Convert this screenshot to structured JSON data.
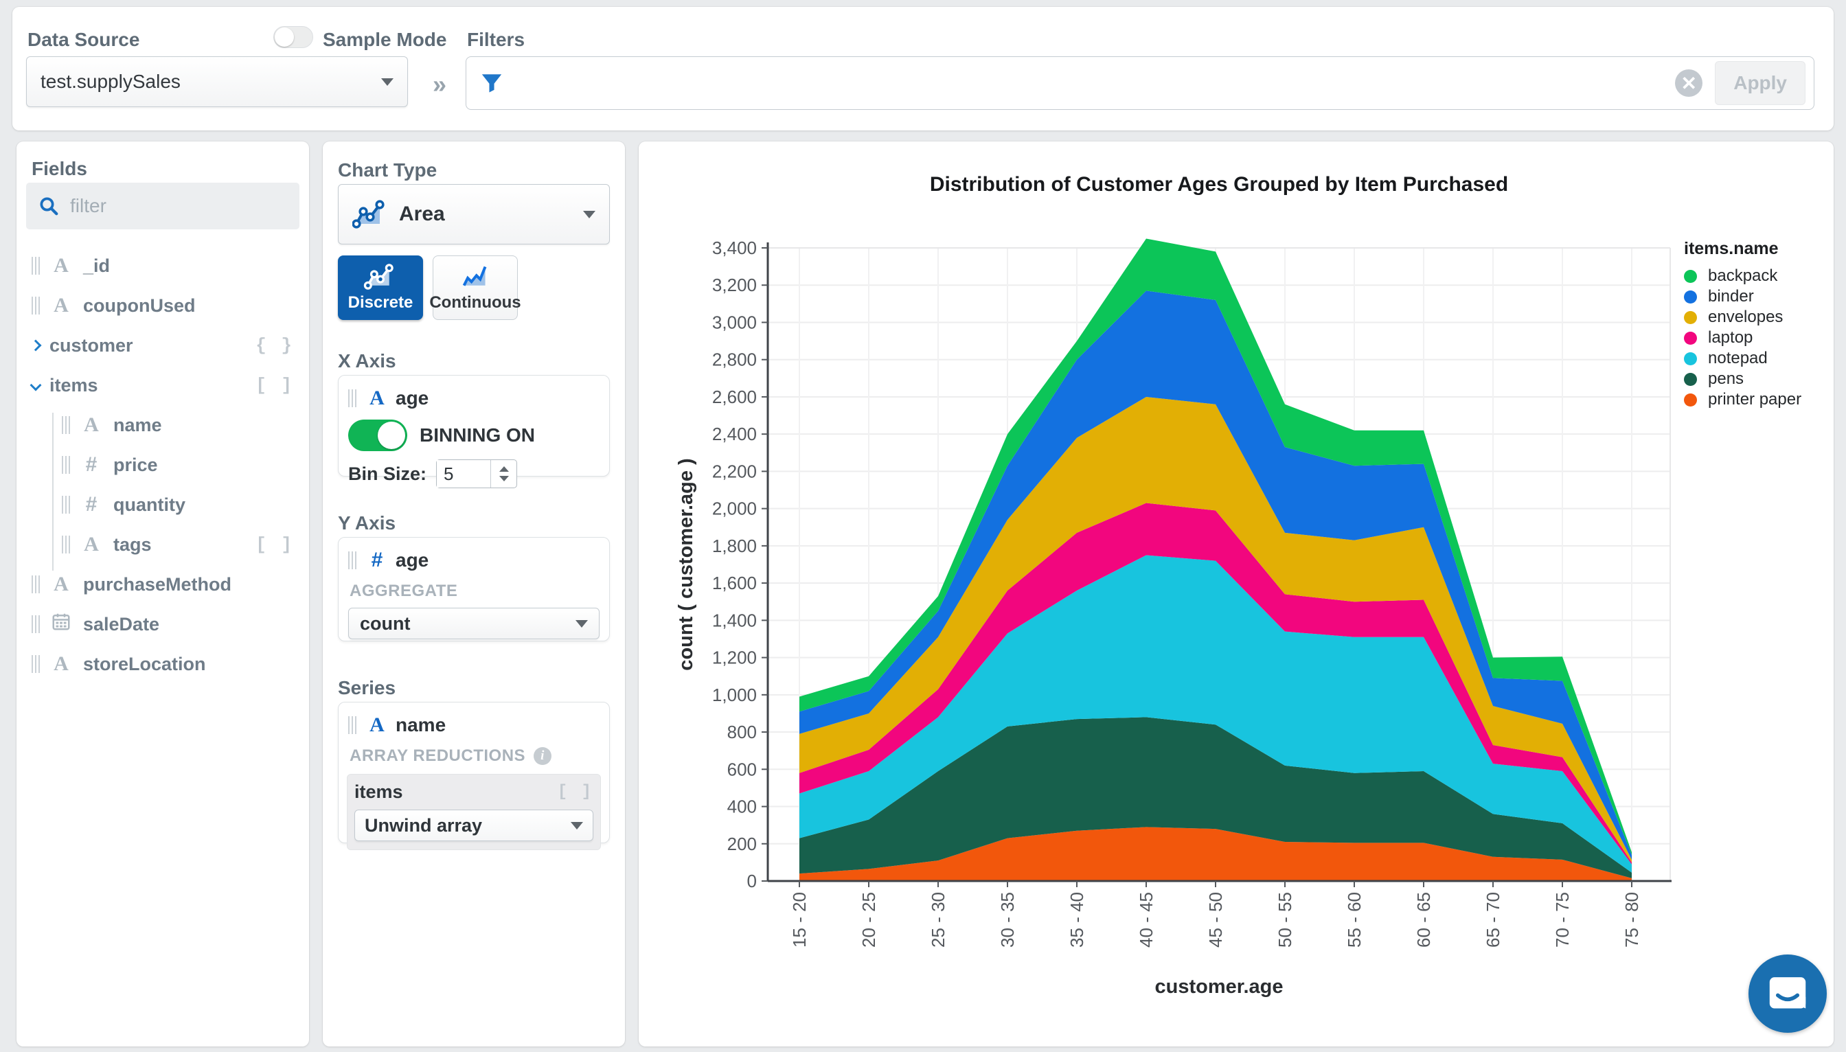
{
  "topbar": {
    "data_source_label": "Data Source",
    "data_source_value": "test.supplySales",
    "sample_mode_label": "Sample Mode",
    "sample_mode_on": false,
    "filters_label": "Filters",
    "filters_value": "",
    "apply_label": "Apply"
  },
  "fields_panel": {
    "title": "Fields",
    "filter_placeholder": "filter",
    "fields": [
      {
        "label": "_id",
        "type": "string",
        "indent": 0
      },
      {
        "label": "couponUsed",
        "type": "string",
        "indent": 0
      },
      {
        "label": "customer",
        "type": "object",
        "chevron": "right",
        "badge": "{ }",
        "indent": 0
      },
      {
        "label": "items",
        "type": "array",
        "chevron": "down",
        "badge": "[ ]",
        "indent": 0
      },
      {
        "label": "name",
        "type": "string",
        "indent": 1
      },
      {
        "label": "price",
        "type": "number",
        "indent": 1
      },
      {
        "label": "quantity",
        "type": "number",
        "indent": 1
      },
      {
        "label": "tags",
        "type": "string",
        "badge": "[ ]",
        "indent": 1
      },
      {
        "label": "purchaseMethod",
        "type": "string",
        "indent": 0
      },
      {
        "label": "saleDate",
        "type": "date",
        "indent": 0
      },
      {
        "label": "storeLocation",
        "type": "string",
        "indent": 0
      }
    ]
  },
  "chart_settings": {
    "chart_type_label": "Chart Type",
    "chart_type_value": "Area",
    "discrete_label": "Discrete",
    "continuous_label": "Continuous",
    "x_axis_label": "X Axis",
    "x_field": "age",
    "binning_label": "BINNING ON",
    "bin_size_label": "Bin Size:",
    "bin_size_value": "5",
    "y_axis_label": "Y Axis",
    "y_field": "age",
    "aggregate_label": "AGGREGATE",
    "aggregate_value": "count",
    "series_label": "Series",
    "series_field": "name",
    "array_reductions_label": "ARRAY REDUCTIONS",
    "array_field": "items",
    "array_field_badge": "[ ]",
    "array_reduction_value": "Unwind array"
  },
  "chart_data": {
    "type": "area",
    "stacked": true,
    "title": "Distribution of Customer Ages Grouped by Item Purchased",
    "xlabel": "customer.age",
    "ylabel": "count ( customer.age )",
    "legend_title": "items.name",
    "legend_position": "right",
    "grid": true,
    "ylim": [
      0,
      3400
    ],
    "ytick_step": 200,
    "categories": [
      "15 - 20",
      "20 - 25",
      "25 - 30",
      "30 - 35",
      "35 - 40",
      "40 - 45",
      "45 - 50",
      "50 - 55",
      "55 - 60",
      "60 - 65",
      "65 - 70",
      "70 - 75",
      "75 - 80"
    ],
    "stack_order_note": "series listed bottom-to-top of the stack",
    "series": [
      {
        "name": "printer paper",
        "color": "#F2570C",
        "values": [
          40,
          65,
          110,
          230,
          270,
          290,
          280,
          210,
          205,
          205,
          130,
          115,
          15
        ]
      },
      {
        "name": "pens",
        "color": "#17604C",
        "values": [
          190,
          265,
          480,
          600,
          600,
          590,
          560,
          410,
          375,
          385,
          230,
          195,
          30
        ]
      },
      {
        "name": "notepad",
        "color": "#18C4DE",
        "values": [
          240,
          260,
          290,
          500,
          690,
          870,
          880,
          720,
          730,
          720,
          270,
          280,
          45
        ]
      },
      {
        "name": "laptop",
        "color": "#F2067E",
        "values": [
          110,
          115,
          150,
          230,
          310,
          280,
          270,
          200,
          190,
          200,
          100,
          75,
          10
        ]
      },
      {
        "name": "envelopes",
        "color": "#E2AF05",
        "values": [
          210,
          195,
          280,
          380,
          510,
          570,
          570,
          330,
          330,
          390,
          210,
          180,
          15
        ]
      },
      {
        "name": "binder",
        "color": "#1371E0",
        "values": [
          120,
          120,
          140,
          290,
          420,
          570,
          560,
          460,
          400,
          340,
          150,
          230,
          25
        ]
      },
      {
        "name": "backpack",
        "color": "#0CC558",
        "values": [
          80,
          80,
          80,
          170,
          100,
          280,
          260,
          230,
          190,
          180,
          110,
          130,
          15
        ]
      }
    ],
    "legend_order": [
      "backpack",
      "binder",
      "envelopes",
      "laptop",
      "notepad",
      "pens",
      "printer paper"
    ]
  }
}
